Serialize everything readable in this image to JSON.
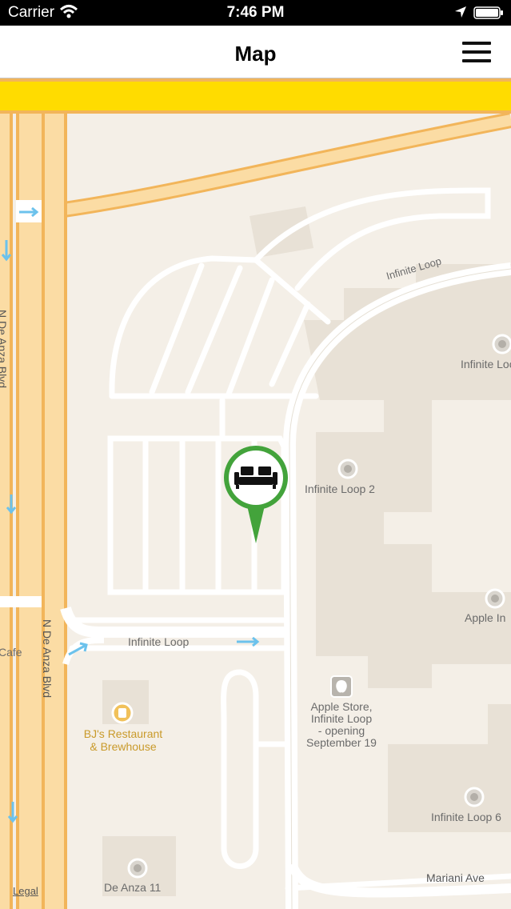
{
  "status_bar": {
    "carrier": "Carrier",
    "time": "7:46 PM"
  },
  "nav": {
    "title": "Map",
    "menu_icon": "hamburger-menu-icon"
  },
  "map": {
    "streets": {
      "n_de_anza_left": "N De Anza Blvd",
      "n_de_anza_right": "N De Anza Blvd",
      "infinite_loop_top": "Infinite Loop",
      "infinite_loop_bottom": "Infinite Loop",
      "mariani_ave": "Mariani Ave"
    },
    "places": {
      "infinite_loop_2": "Infinite Loop 2",
      "infinite_loop_top_right": "Infinite Loop",
      "apple_inc": "Apple In",
      "apple_store": [
        "Apple Store,",
        "Infinite Loop",
        "- opening",
        "September 19"
      ],
      "bjs": [
        "BJ's Restaurant",
        "& Brewhouse"
      ],
      "infinite_loop_bottom_right": "Infinite Loop 6",
      "de_anza_11": "De Anza 11",
      "cafe": "Cafe"
    },
    "pin": {
      "icon": "sofa-icon",
      "color": "#43a33b"
    },
    "legal": "Legal"
  },
  "colors": {
    "map_bg": "#f4efe7",
    "highway": "#ffdc00",
    "road_orange": "#f2b55a",
    "pin_green": "#43a33b"
  }
}
